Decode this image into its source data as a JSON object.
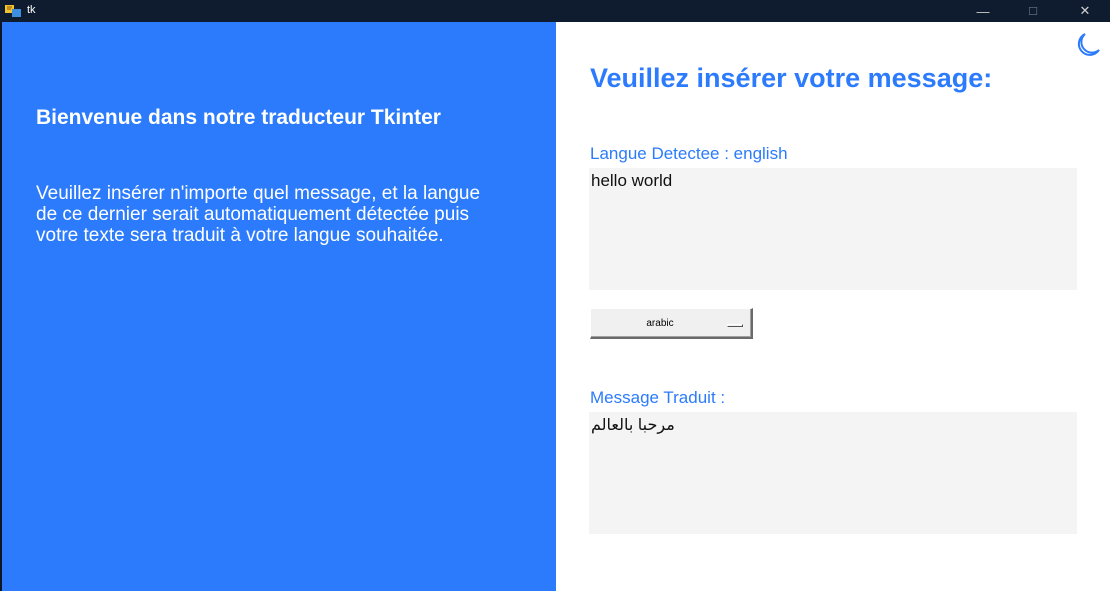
{
  "window": {
    "title": "tk",
    "controls": {
      "minimize": "—",
      "maximize": "☐",
      "close": "✕"
    },
    "icon": "tk-feather-icon"
  },
  "left_panel": {
    "welcome_title": "Bienvenue dans notre traducteur Tkinter",
    "welcome_text": "Veuillez insérer n'importe quel message, et la langue de ce dernier serait automatiquement détectée puis votre texte sera traduit à votre langue souhaitée.",
    "background_color": "#2b7bfc"
  },
  "right_panel": {
    "theme_toggle_icon": "moon-icon",
    "heading": "Veuillez insérer votre message:",
    "detected_label": "Langue Detectee : english",
    "input_text": "hello world",
    "language_select": {
      "selected": "arabic"
    },
    "translated_label": "Message Traduit :",
    "output_text": "مرحبا بالعالم",
    "accent_color": "#2b7bfc"
  }
}
